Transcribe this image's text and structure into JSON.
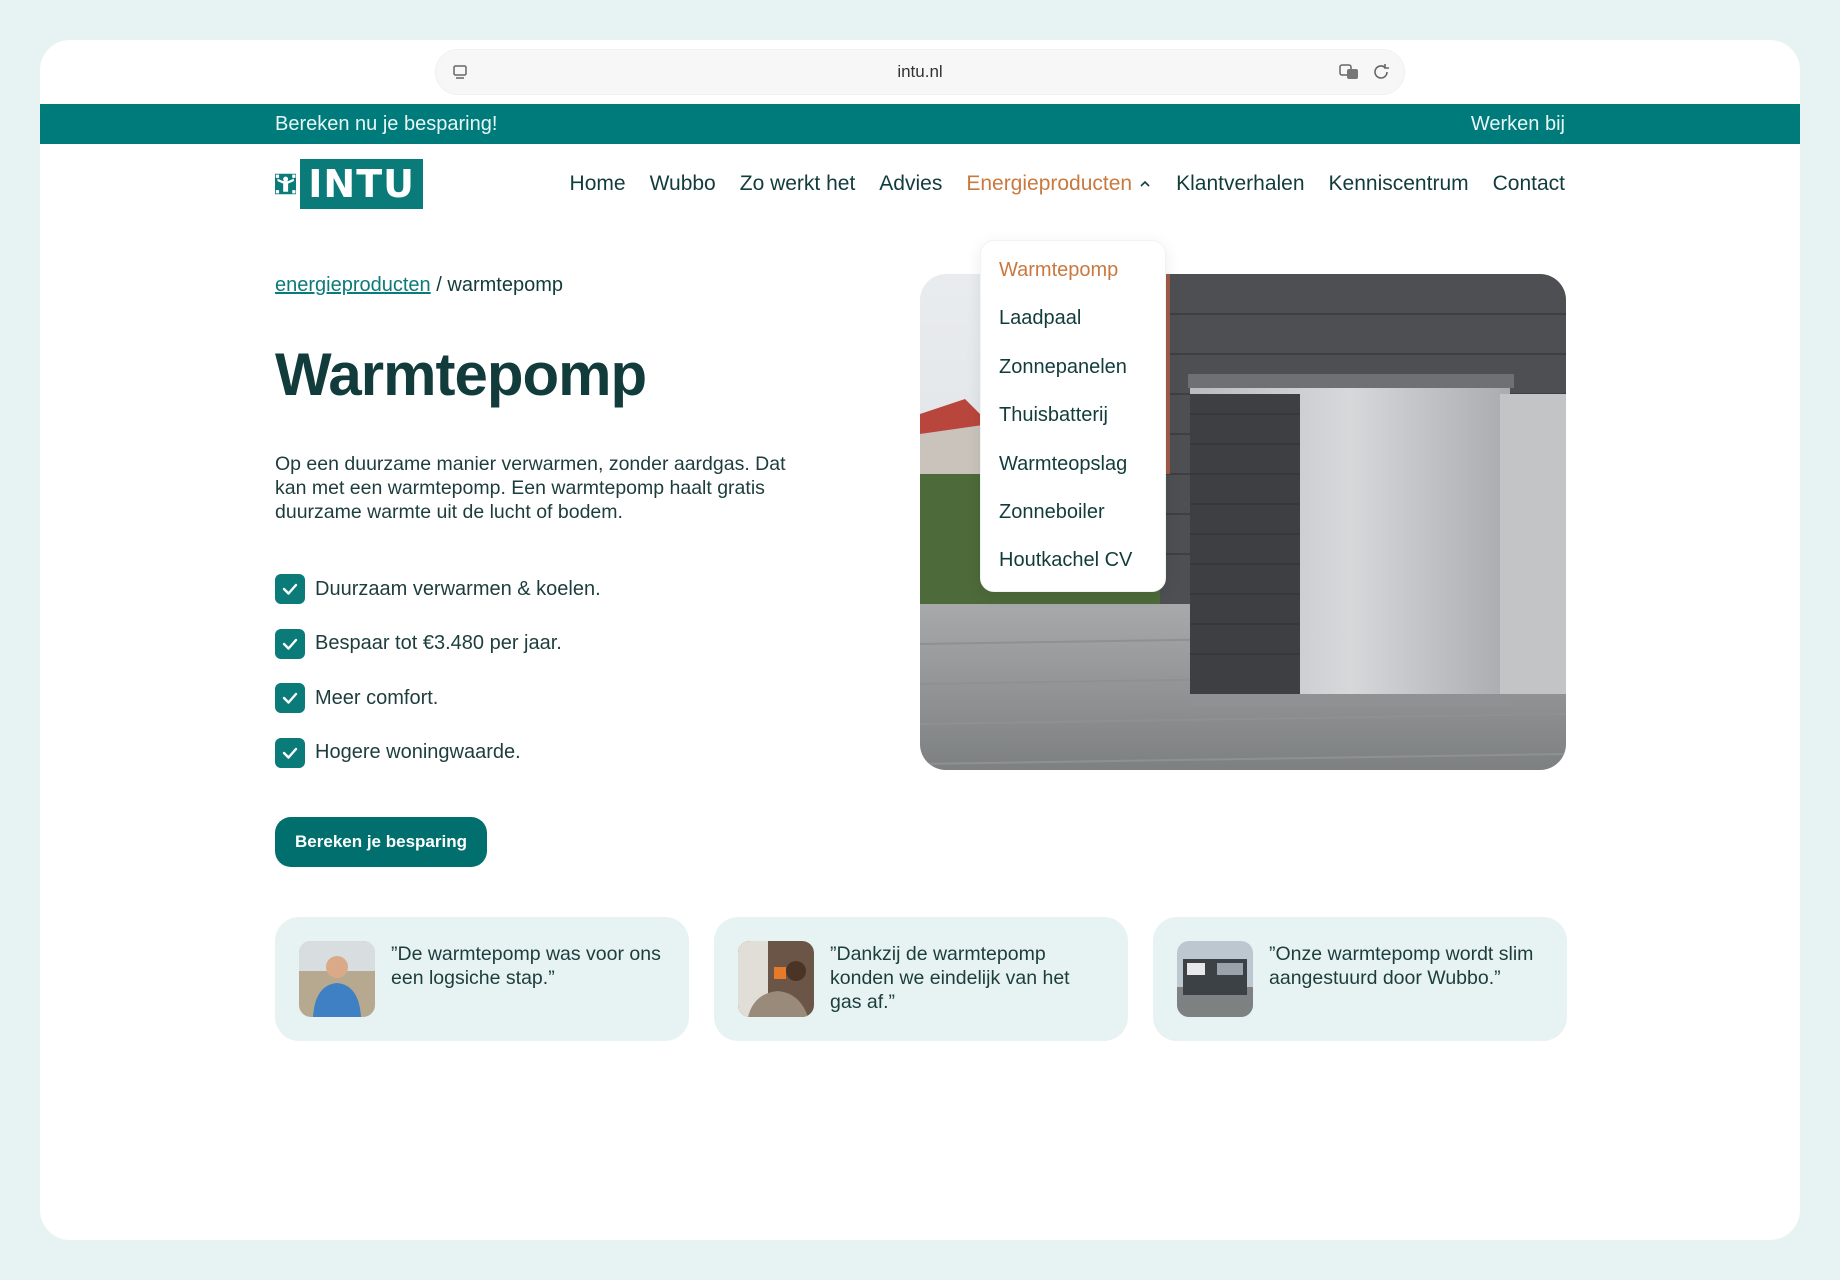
{
  "browser": {
    "url": "intu.nl"
  },
  "topbar": {
    "promo": "Bereken nu je besparing!",
    "jobs": "Werken bij"
  },
  "logo": {
    "text": "INTU"
  },
  "nav": {
    "items": [
      "Home",
      "Wubbo",
      "Zo werkt het",
      "Advies",
      "Energieproducten",
      "Klantverhalen",
      "Kenniscentrum",
      "Contact"
    ],
    "active_index": 4
  },
  "dropdown": {
    "items": [
      "Warmtepomp",
      "Laadpaal",
      "Zonnepanelen",
      "Thuisbatterij",
      "Warmteopslag",
      "Zonneboiler",
      "Houtkachel CV"
    ],
    "selected_index": 0
  },
  "breadcrumb": {
    "parent": "energieproducten",
    "separator": "/",
    "current": "warmtepomp"
  },
  "page": {
    "title": "Warmtepomp",
    "intro": "Op een duurzame manier verwarmen, zonder aardgas. Dat kan met een warmtepomp. Een warmtepomp haalt gratis duurzame warmte uit de lucht of bodem.",
    "benefits": [
      "Duurzaam verwarmen & koelen.",
      "Bespaar tot €3.480 per jaar.",
      "Meer comfort.",
      "Hogere woningwaarde."
    ],
    "cta": "Bereken je besparing"
  },
  "testimonials": [
    {
      "quote": "”De warmtepomp was voor ons een logsiche stap.”"
    },
    {
      "quote": "”Dankzij de warmtepomp konden we eindelijk van het gas af.”"
    },
    {
      "quote": "”Onze warmtepomp wordt slim aangestuurd door Wubbo.”"
    }
  ],
  "colors": {
    "teal": "#007b7b",
    "accent": "#c9793f",
    "text": "#123c3b",
    "card_bg": "#e6f3f2"
  }
}
